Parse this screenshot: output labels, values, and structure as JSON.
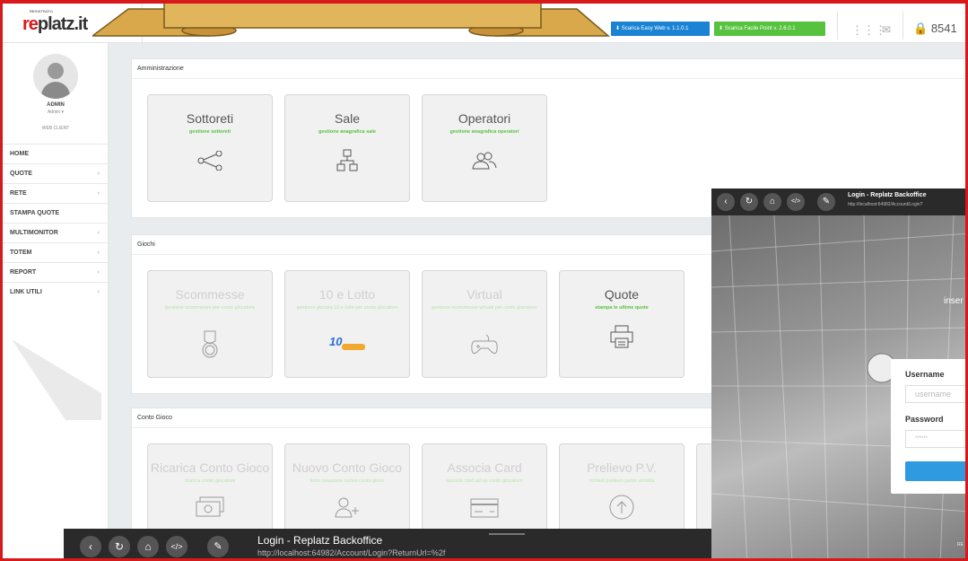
{
  "banner": {
    "text": ""
  },
  "header": {
    "logo_small": "REGISTRATO",
    "logo_text": "platz.it",
    "logo_prefix": "re",
    "download_easy": "Scarica Easy Web v. 1.1.0.1",
    "download_point": "Scarica Facile Point v. 2.6.0.1",
    "credit": "8541"
  },
  "sidebar": {
    "user_name": "ADMIN",
    "user_role": "Admin ▾",
    "user_client": "WEB CLIENT",
    "items": [
      {
        "label": "HOME",
        "chevron": ""
      },
      {
        "label": "QUOTE",
        "chevron": "‹"
      },
      {
        "label": "RETE",
        "chevron": "‹"
      },
      {
        "label": "STAMPA QUOTE",
        "chevron": ""
      },
      {
        "label": "MULTIMONITOR",
        "chevron": "‹"
      },
      {
        "label": "TOTEM",
        "chevron": "‹"
      },
      {
        "label": "REPORT",
        "chevron": "‹"
      },
      {
        "label": "LINK UTILI",
        "chevron": "‹"
      }
    ]
  },
  "sections": {
    "amministrazione": {
      "title": "Amministrazione",
      "tiles": [
        {
          "title": "Sottoreti",
          "subtitle": "gestione sottoreti",
          "icon": "share-icon"
        },
        {
          "title": "Sale",
          "subtitle": "gestione anagrafica sale",
          "icon": "hierarchy-icon"
        },
        {
          "title": "Operatori",
          "subtitle": "gestione anagrafica operatori",
          "icon": "users-icon"
        }
      ]
    },
    "giochi": {
      "title": "Giochi",
      "tiles": [
        {
          "title": "Scommesse",
          "subtitle": "gestione scommesse per conto giocatore",
          "icon": "medal-icon"
        },
        {
          "title": "10 e Lotto",
          "subtitle": "gestione giocata 10 e lotto per conto giocatore",
          "icon": "lotto-logo-icon"
        },
        {
          "title": "Virtual",
          "subtitle": "gestione scommesse virtuali per conto giocatore",
          "icon": "gamepad-icon"
        },
        {
          "title": "Quote",
          "subtitle": "stampa le ultime quote",
          "icon": "printer-icon"
        }
      ]
    },
    "conto_gioco": {
      "title": "Conto Gioco",
      "tiles": [
        {
          "title": "Ricarica Conto Gioco",
          "subtitle": "ricarica conto giocatore",
          "icon": "cash-icon"
        },
        {
          "title": "Nuovo Conto Gioco",
          "subtitle": "form creazione nuovo conto gioco",
          "icon": "add-user-icon"
        },
        {
          "title": "Associa Card",
          "subtitle": "associa card ad un conto giocatore",
          "icon": "card-icon"
        },
        {
          "title": "Prelievo P.V.",
          "subtitle": "richiedi prelievo punto vendita",
          "icon": "upload-icon"
        }
      ]
    }
  },
  "taskbar": {
    "title": "Login - Replatz Backoffice",
    "url": "http://localhost:64982/Account/Login?ReturnUrl=%2f"
  },
  "login_window": {
    "title": "Login - Replatz Backoffice",
    "url": "http://localhost:64982/Account/Login?",
    "headline_partial": "inser",
    "username_label": "Username",
    "username_placeholder": "username",
    "password_label": "Password",
    "password_placeholder": "******",
    "footer_partial": "RE"
  },
  "colors": {
    "brand": "#d7191c",
    "accent_green": "#56c23e",
    "accent_blue": "#1a83d3"
  }
}
